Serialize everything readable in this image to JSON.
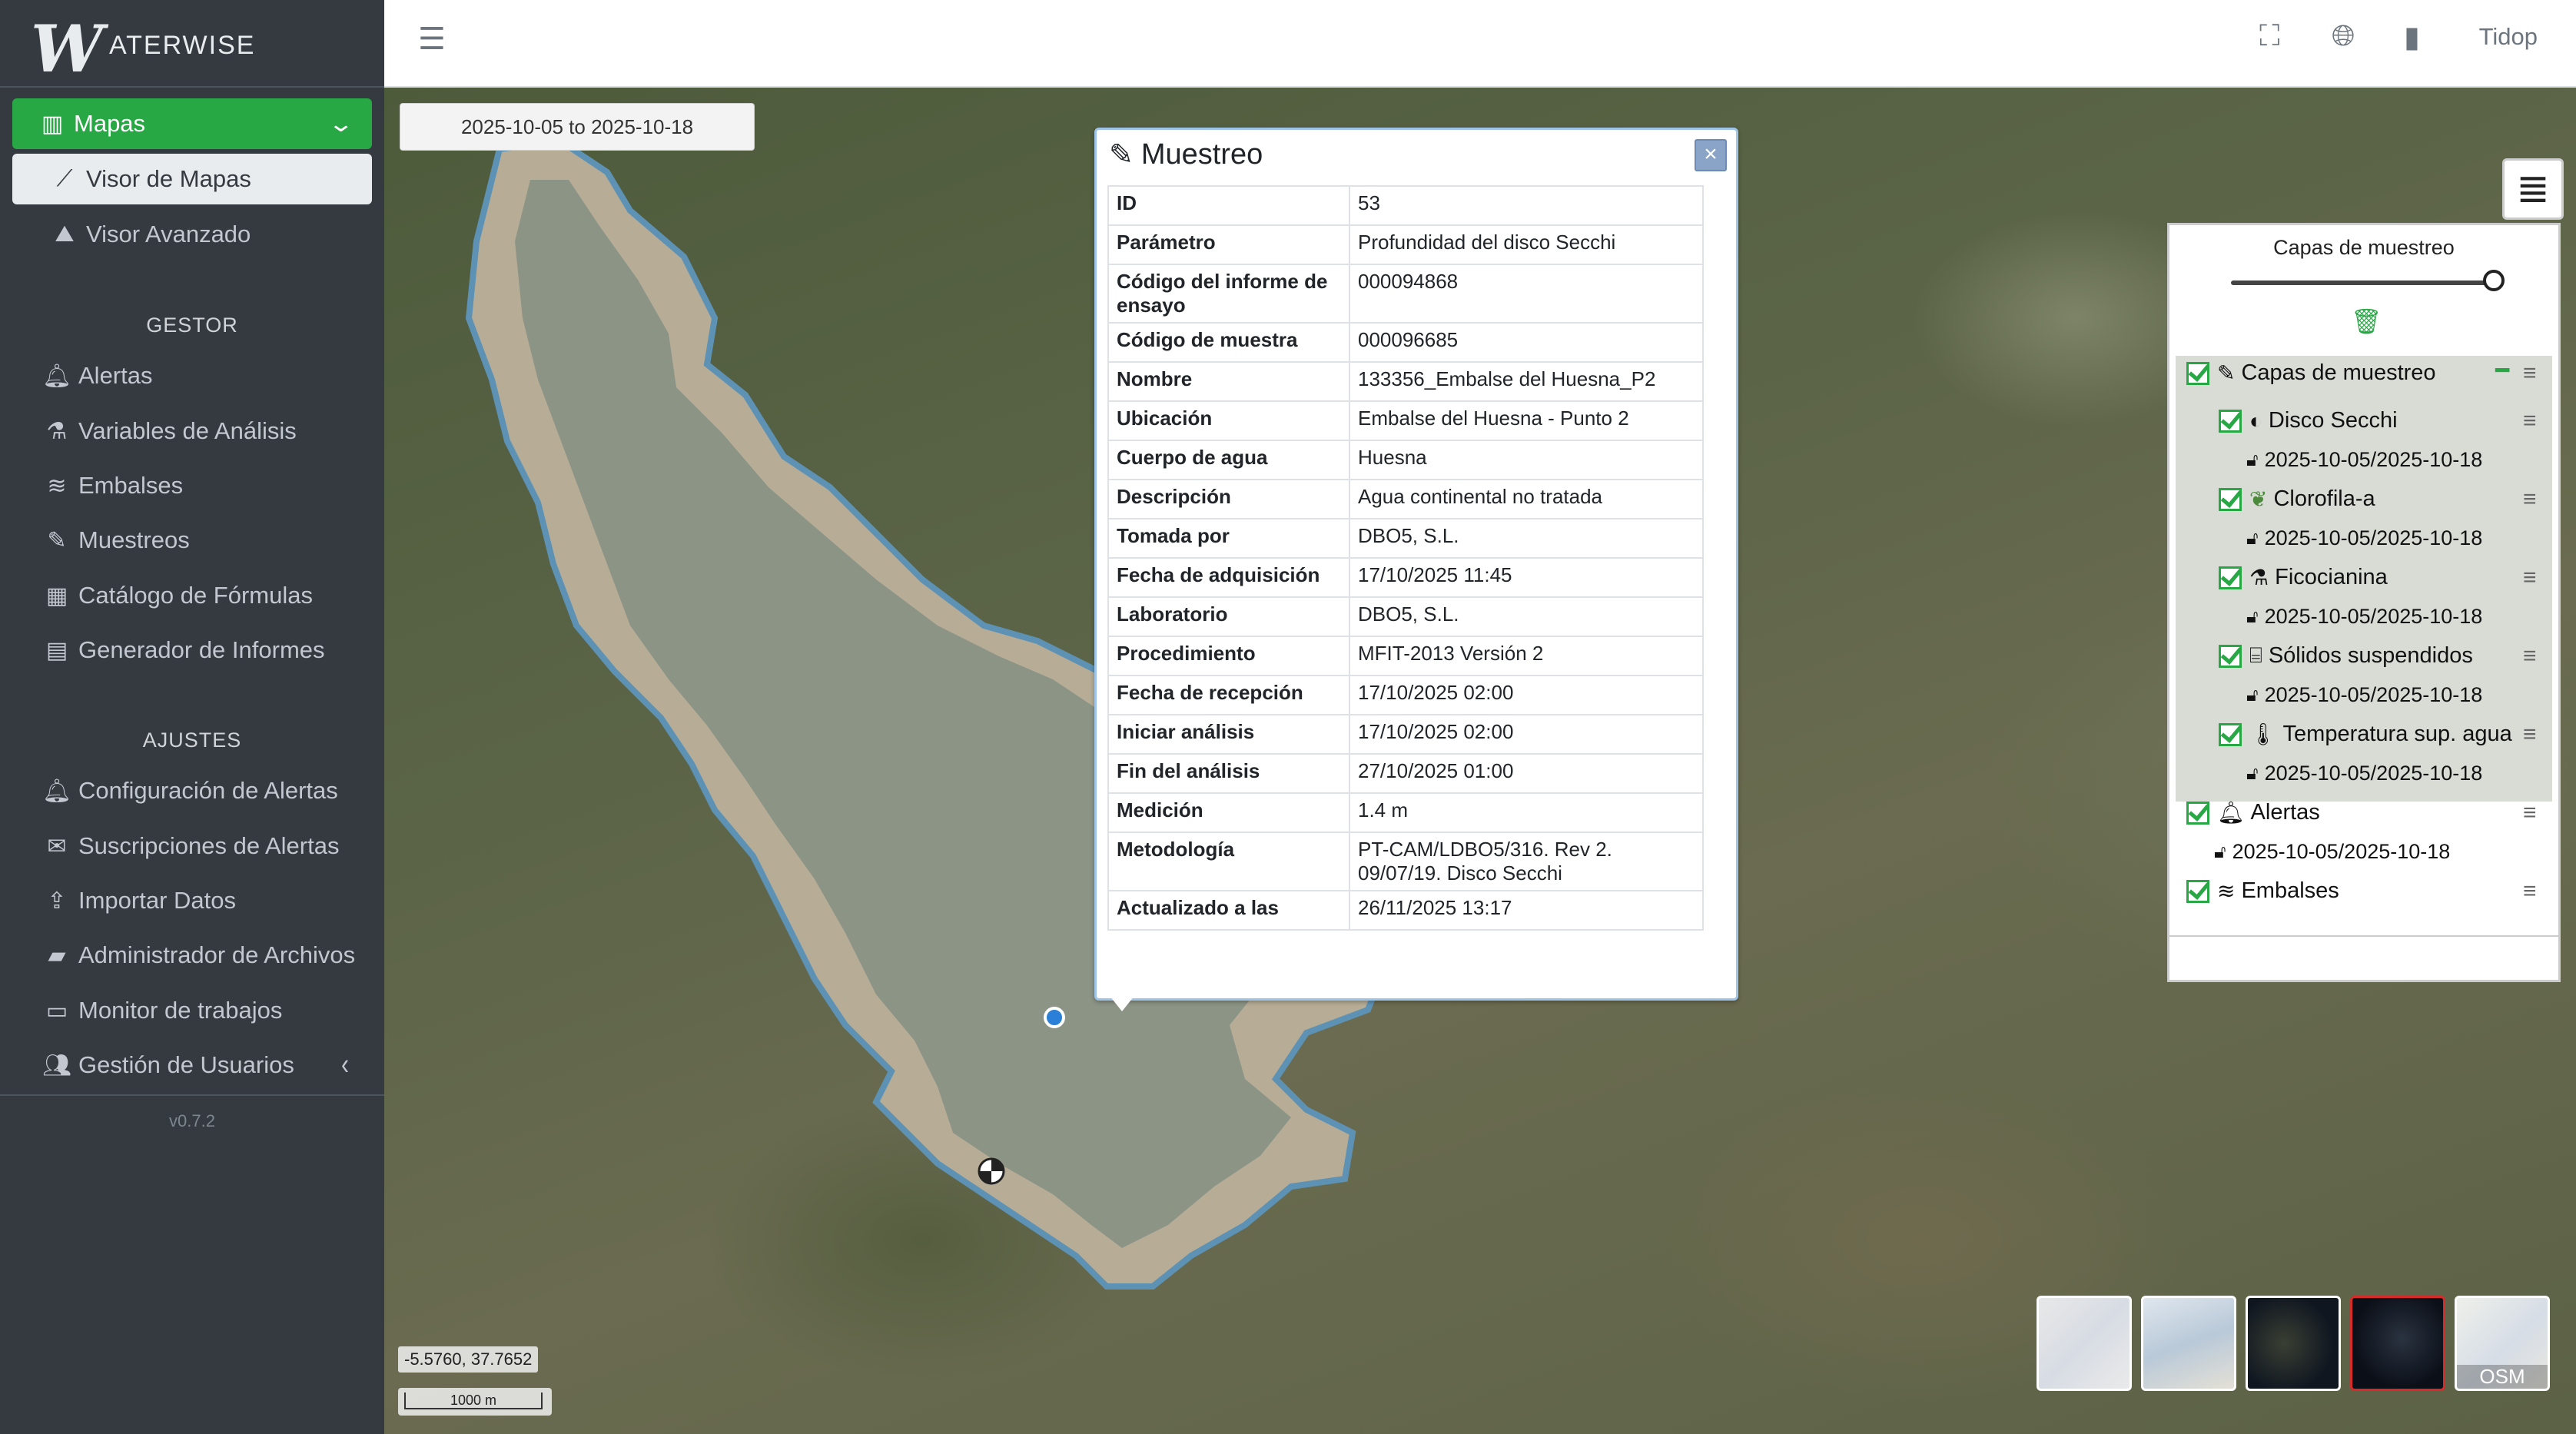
{
  "brand": {
    "logo_letter": "W",
    "logo_text": "ATERWISE"
  },
  "sidebar": {
    "mapas": "Mapas",
    "visor_mapas": "Visor de Mapas",
    "visor_avanzado": "Visor Avanzado",
    "gestor_header": "GESTOR",
    "gestor_items": [
      "Alertas",
      "Variables de Análisis",
      "Embalses",
      "Muestreos",
      "Catálogo de Fórmulas",
      "Generador de Informes"
    ],
    "ajustes_header": "AJUSTES",
    "ajustes_items": [
      "Configuración de Alertas",
      "Suscripciones de Alertas",
      "Importar Datos",
      "Administrador de Archivos",
      "Monitor de trabajos",
      "Gestión de Usuarios"
    ],
    "version": "v0.7.2"
  },
  "topbar": {
    "user": "Tidop"
  },
  "map": {
    "date_range": "2025-10-05 to 2025-10-18",
    "coords": "-5.5760, 37.7652",
    "scale": "1000 m"
  },
  "popup": {
    "title": "Muestreo",
    "rows": [
      [
        "ID",
        "53"
      ],
      [
        "Parámetro",
        "Profundidad del disco Secchi"
      ],
      [
        "Código del informe de ensayo",
        "000094868"
      ],
      [
        "Código de muestra",
        "000096685"
      ],
      [
        "Nombre",
        "133356_Embalse del Huesna_P2"
      ],
      [
        "Ubicación",
        "Embalse del Huesna - Punto 2"
      ],
      [
        "Cuerpo de agua",
        "Huesna"
      ],
      [
        "Descripción",
        "Agua continental no tratada"
      ],
      [
        "Tomada por",
        "DBO5, S.L."
      ],
      [
        "Fecha de adquisición",
        "17/10/2025 11:45"
      ],
      [
        "Laboratorio",
        "DBO5, S.L."
      ],
      [
        "Procedimiento",
        "MFIT-2013 Versión 2"
      ],
      [
        "Fecha de recepción",
        "17/10/2025 02:00"
      ],
      [
        "Iniciar análisis",
        "17/10/2025 02:00"
      ],
      [
        "Fin del análisis",
        "27/10/2025 01:00"
      ],
      [
        "Medición",
        "1.4 m"
      ],
      [
        "Metodología",
        "PT-CAM/LDBO5/316. Rev 2. 09/07/19. Disco Secchi"
      ],
      [
        "Actualizado a las",
        "26/11/2025 13:17"
      ]
    ]
  },
  "layers": {
    "title": "Capas de muestreo",
    "group": "Capas de muestreo",
    "sublayers": [
      "Disco Secchi",
      "Clorofila-a",
      "Ficocianina",
      "Sólidos suspendidos",
      "Temperatura sup. agua"
    ],
    "date": "2025-10-05/2025-10-18",
    "alertas": "Alertas",
    "embalses": "Embalses"
  },
  "basemaps": [
    "OSM"
  ]
}
